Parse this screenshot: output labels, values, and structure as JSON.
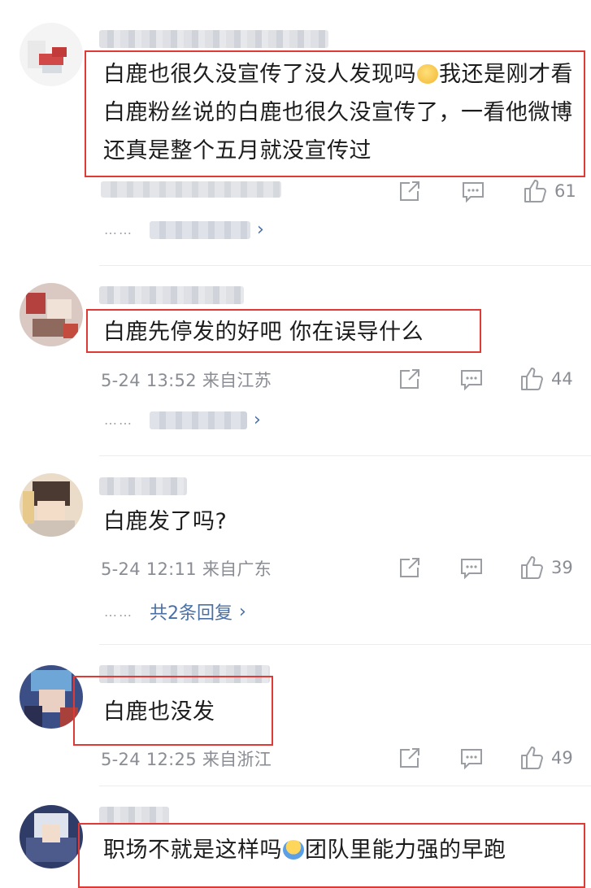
{
  "comments": [
    {
      "text_before": "白鹿也很久没宣传了没人发现吗",
      "text_after": "我还是刚才看白鹿粉丝说的白鹿也很久没宣传了，一看他微博还真是整个五月就没宣传过",
      "likes": "61"
    },
    {
      "text": "白鹿先停发的好吧 你在误导什么",
      "time_location": "5-24 13:52 来自江苏",
      "likes": "44"
    },
    {
      "text": "白鹿发了吗?",
      "time_location": "5-24 12:11 来自广东",
      "likes": "39",
      "reply_link": "共2条回复"
    },
    {
      "text": "白鹿也没发",
      "time_location": "5-24 12:25 来自浙江",
      "likes": "49"
    },
    {
      "text_before": "职场不就是这样吗",
      "text_after": "团队里能力强的早跑"
    }
  ],
  "icons": {
    "share": "share-icon",
    "comment": "comment-icon",
    "like": "like-icon",
    "reply_chevron": "chevron-right-icon"
  },
  "colors": {
    "highlight_box": "#e03a36",
    "meta_text": "#8a8d93",
    "reply_link": "#4a6fa5"
  }
}
